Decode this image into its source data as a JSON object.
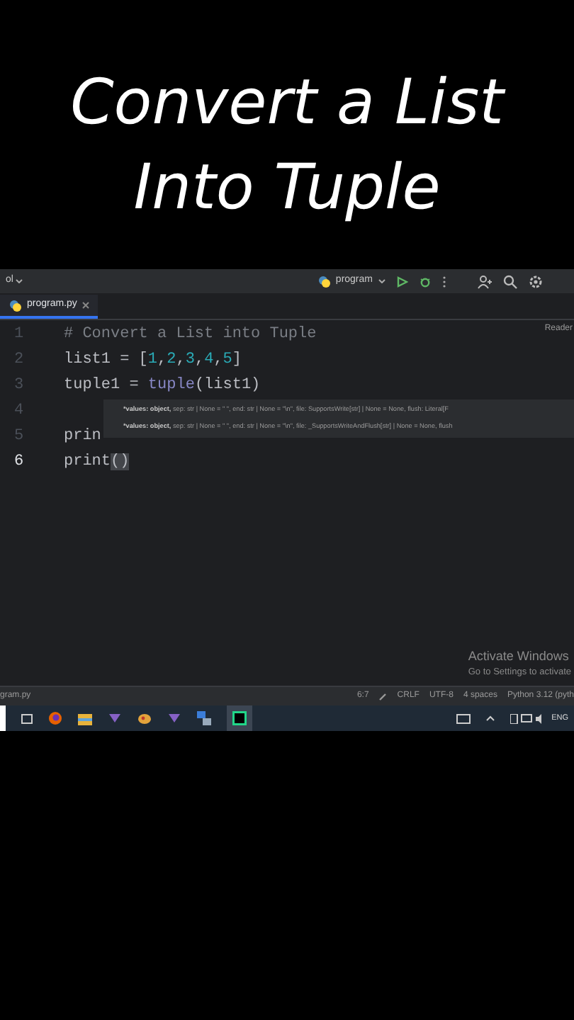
{
  "caption": {
    "lines": [
      "Convert a List",
      "Into Tuple"
    ]
  },
  "toolbar": {
    "project": "ol",
    "run_config": "program"
  },
  "tabs": [
    {
      "label": "program.py",
      "selected": true
    }
  ],
  "editor": {
    "reader_mode": "Reader",
    "lines": [
      {
        "number": "1",
        "tokens": [
          {
            "kind": "comment",
            "text": "# Convert a List into Tuple"
          }
        ]
      },
      {
        "number": "2",
        "tokens": [
          {
            "kind": "name",
            "text": "list1 = ["
          },
          {
            "kind": "number",
            "text": "1"
          },
          {
            "kind": "name",
            "text": ","
          },
          {
            "kind": "number",
            "text": "2"
          },
          {
            "kind": "name",
            "text": ","
          },
          {
            "kind": "number",
            "text": "3"
          },
          {
            "kind": "name",
            "text": ","
          },
          {
            "kind": "number",
            "text": "4"
          },
          {
            "kind": "name",
            "text": ","
          },
          {
            "kind": "number",
            "text": "5"
          },
          {
            "kind": "name",
            "text": "]"
          }
        ]
      },
      {
        "number": "3",
        "tokens": [
          {
            "kind": "name",
            "text": "tuple1 = "
          },
          {
            "kind": "builtin",
            "text": "tuple"
          },
          {
            "kind": "name",
            "text": "(list1)"
          }
        ]
      },
      {
        "number": "4"
      },
      {
        "number": "5",
        "tokens": [
          {
            "kind": "name",
            "text": "prin"
          }
        ]
      },
      {
        "number": "6",
        "current": true,
        "tokens": [
          {
            "kind": "name",
            "text": "print"
          },
          {
            "kind": "bracket",
            "text": "()"
          }
        ]
      }
    ],
    "hint": [
      {
        "bold": "*values: object,",
        "rest": " sep: str | None = \" \", end: str | None = \"\\n\", file: SupportsWrite[str] | None = None, flush: Literal[F"
      },
      {
        "bold": "*values: object,",
        "rest": " sep: str | None = \" \", end: str | None = \"\\n\", file: _SupportsWriteAndFlush[str] | None = None, flush"
      }
    ]
  },
  "activation": {
    "title": "Activate Windows",
    "subtitle": "Go to Settings to activate"
  },
  "status_bar": {
    "file": "gram.py",
    "items": [
      "6:7",
      "CRLF",
      "UTF-8",
      "4 spaces",
      "Python 3.12 (pyth"
    ]
  },
  "taskbar": {
    "language": "ENG"
  }
}
